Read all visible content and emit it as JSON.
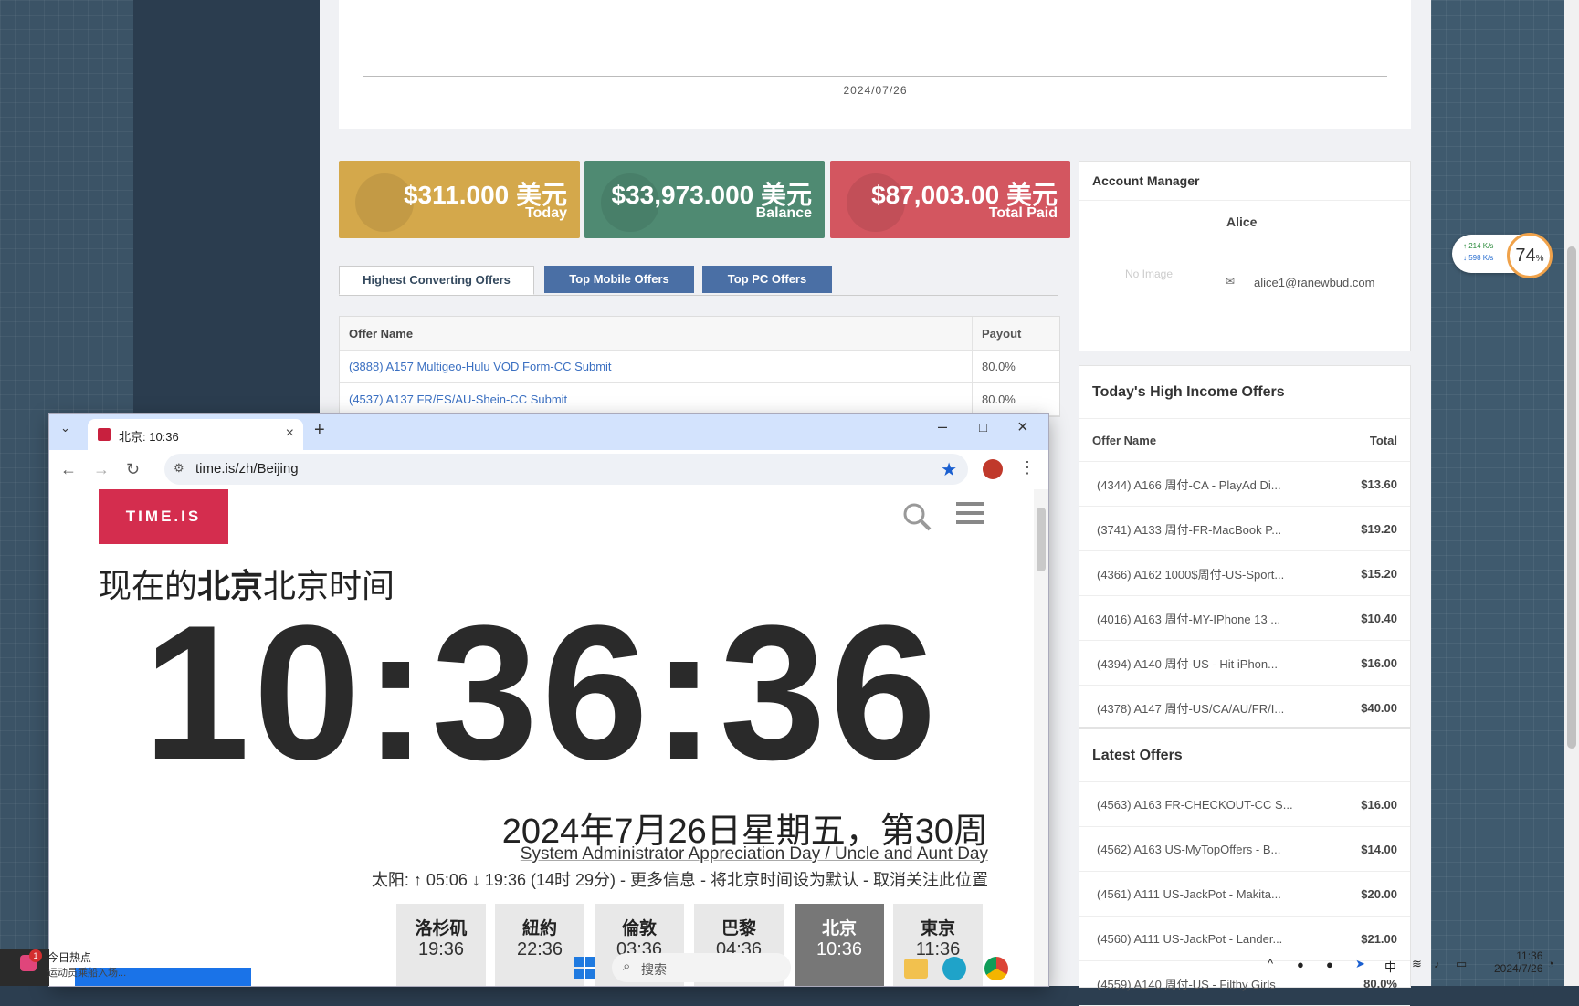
{
  "chart": {
    "xtick": "2024/07/26"
  },
  "stats": [
    {
      "amount": "$311.000 美元",
      "label": "Today",
      "color": "#d4a84b"
    },
    {
      "amount": "$33,973.000 美元",
      "label": "Balance",
      "color": "#4f8a72"
    },
    {
      "amount": "$87,003.00 美元",
      "label": "Total Paid",
      "color": "#d35660"
    }
  ],
  "tabs": [
    "Highest Converting Offers",
    "Top Mobile Offers",
    "Top PC Offers"
  ],
  "offers": {
    "headers": [
      "Offer Name",
      "Payout"
    ],
    "rows": [
      {
        "name": "(3888) A157 Multigeo-Hulu VOD Form-CC Submit",
        "payout": "80.0%"
      },
      {
        "name": "(4537) A137 FR/ES/AU-Shein-CC Submit",
        "payout": "80.0%"
      }
    ]
  },
  "account_manager": {
    "title": "Account Manager",
    "name": "Alice",
    "no_image": "No Image",
    "email": "alice1@ranewbud.com"
  },
  "high_income": {
    "title": "Today's High Income Offers",
    "headers": [
      "Offer Name",
      "Total"
    ],
    "rows": [
      {
        "name": "(4344) A166 周付-CA - PlayAd Di...",
        "total": "$13.60"
      },
      {
        "name": "(3741) A133 周付-FR-MacBook P...",
        "total": "$19.20"
      },
      {
        "name": "(4366) A162 1000$周付-US-Sport...",
        "total": "$15.20"
      },
      {
        "name": "(4016) A163 周付-MY-IPhone 13 ...",
        "total": "$10.40"
      },
      {
        "name": "(4394) A140 周付-US - Hit iPhon...",
        "total": "$16.00"
      },
      {
        "name": "(4378) A147 周付-US/CA/AU/FR/I...",
        "total": "$40.00"
      }
    ]
  },
  "latest": {
    "title": "Latest Offers",
    "rows": [
      {
        "name": "(4563) A163 FR-CHECKOUT-CC S...",
        "total": "$16.00"
      },
      {
        "name": "(4562) A163 US-MyTopOffers - B...",
        "total": "$14.00"
      },
      {
        "name": "(4561) A111 US-JackPot - Makita...",
        "total": "$20.00"
      },
      {
        "name": "(4560) A111 US-JackPot - Lander...",
        "total": "$21.00"
      },
      {
        "name": "(4559) A140 周付-US - Filthy Girls",
        "total": "80.0%"
      }
    ]
  },
  "net_widget": {
    "up": "↑ 214 K/s",
    "down": "↓ 598 K/s",
    "percent": "74",
    "percent_sign": "%"
  },
  "browser": {
    "tab_title": "北京: 10:36",
    "url": "time.is/zh/Beijing",
    "logo": "TIME.IS",
    "headline_prefix": "现在的",
    "headline_bold": "北京",
    "headline_suffix": "北京时间",
    "clock": "10:36:36",
    "date": "2024年7月26日星期五，第30周",
    "holiday": "System Administrator Appreciation Day / Uncle and Aunt Day",
    "sun": "太阳: ↑ 05:06 ↓ 19:36 (14时 29分) - 更多信息 - 将北京时间设为默认 - 取消关注此位置",
    "cities": [
      {
        "name": "洛杉矶",
        "time": "19:36"
      },
      {
        "name": "紐約",
        "time": "22:36"
      },
      {
        "name": "倫敦",
        "time": "03:36"
      },
      {
        "name": "巴黎",
        "time": "04:36"
      },
      {
        "name": "北京",
        "time": "10:36"
      },
      {
        "name": "東京",
        "time": "11:36"
      }
    ]
  },
  "taskbar": {
    "news_badge": "1",
    "news_title": "今日热点",
    "news_sub": "运动员乘船入场...",
    "search": "搜索",
    "ime": "中",
    "time": "11:36",
    "date": "2024/7/26"
  }
}
